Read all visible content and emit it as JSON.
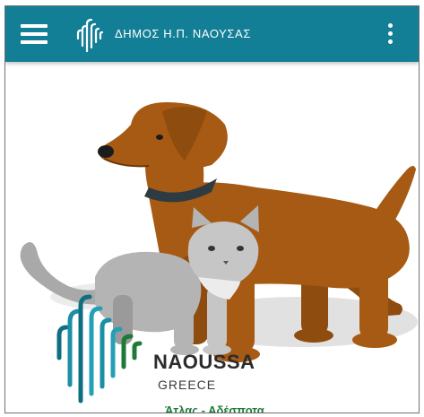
{
  "app": {
    "title": "ΔΗΜΟΣ Η.Π. ΝΑΟΥΣΑΣ",
    "colors": {
      "appbar": "#137f96",
      "accent_green": "#1f7a3a",
      "dog": "#a65a13",
      "cat": "#a9a9a9"
    },
    "icons": {
      "menu": "hamburger-menu-icon",
      "logo": "naoussa-logo-icon",
      "more": "kebab-menu-icon"
    }
  },
  "splash": {
    "brand_name": "NAOUSSA",
    "brand_country": "GREECE",
    "subtitle": "Άτλας - Αδέσποτα"
  }
}
